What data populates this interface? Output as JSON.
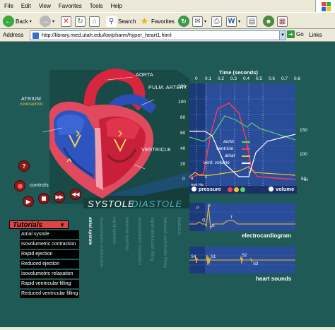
{
  "browser": {
    "menu": [
      "File",
      "Edit",
      "View",
      "Favorites",
      "Tools",
      "Help"
    ],
    "toolbar": {
      "back_label": "Back",
      "search_label": "Search",
      "favorites_label": "Favorites"
    },
    "address_label": "Address",
    "url": "http://library.med.utah.edu/kw/pharm/hyper_heart1.html",
    "go_label": "Go",
    "links_label": "Links"
  },
  "heart": {
    "labels": {
      "aorta": "AORTA",
      "pulm_artery": "PULM. ARTERY",
      "atrium": "ATRIUM",
      "atrium_sub": "contraction",
      "ventricle": "VENTRICLE"
    },
    "controls_label": "controls",
    "question": "?"
  },
  "phase": {
    "systole": "SYSTOLE",
    "diastole": "DIASTOLE",
    "columns": [
      {
        "text": "atrial systole",
        "active": true
      },
      {
        "text": "isovolumetric contraction",
        "active": false
      },
      {
        "text": "rapid ejection",
        "active": false
      },
      {
        "text": "reduced ejection",
        "active": false
      },
      {
        "text": "isovolumetric relaxation",
        "active": false
      },
      {
        "text": "rapid ventricular filling",
        "active": false
      },
      {
        "text": "reduced ventricular filling",
        "active": false
      },
      {
        "text": "diastasis",
        "active": false
      }
    ]
  },
  "tutorials": {
    "title": "Tutorials",
    "items": [
      "Atrial systole",
      "Isovolumetric contraction",
      "Rapid ejection",
      "Reduced ejection",
      "Isovolumetric relaxation",
      "Rapid ventricular filling",
      "Reduced ventricular filling"
    ]
  },
  "pressure_graph": {
    "time_label": "Time (seconds)",
    "time_ticks": [
      "0",
      "0.1",
      "0.2",
      "0.3",
      "0.4",
      "0.5",
      "0.6",
      "0.7",
      "0.8"
    ],
    "left_ticks": [
      "120",
      "100",
      "80",
      "60",
      "40",
      "20",
      "0"
    ],
    "right_ticks": [
      "150",
      "100",
      "50"
    ],
    "unit_left": "mm Hg",
    "unit_right": "ml",
    "legend": [
      "aortic",
      "ventricle",
      "atrial",
      "vent. volume"
    ],
    "legend_colors": [
      "#5bd36b",
      "#ff3a5a",
      "#f2c12e",
      "#ffffff"
    ],
    "pressure_label": "pressure",
    "volume_label": "volume",
    "wave_labels": [
      "a",
      "c",
      "v"
    ]
  },
  "ecg": {
    "title": "electrocardiogram",
    "wave_labels": [
      "P",
      "R",
      "Q",
      "S",
      "T"
    ]
  },
  "heart_sounds": {
    "title": "heart sounds",
    "sound_labels": [
      "S4",
      "S1",
      "S2",
      "S3"
    ]
  },
  "colors": {
    "background": "#1f5a56",
    "panel": "#2a4d9a",
    "accent": "#e04444"
  }
}
